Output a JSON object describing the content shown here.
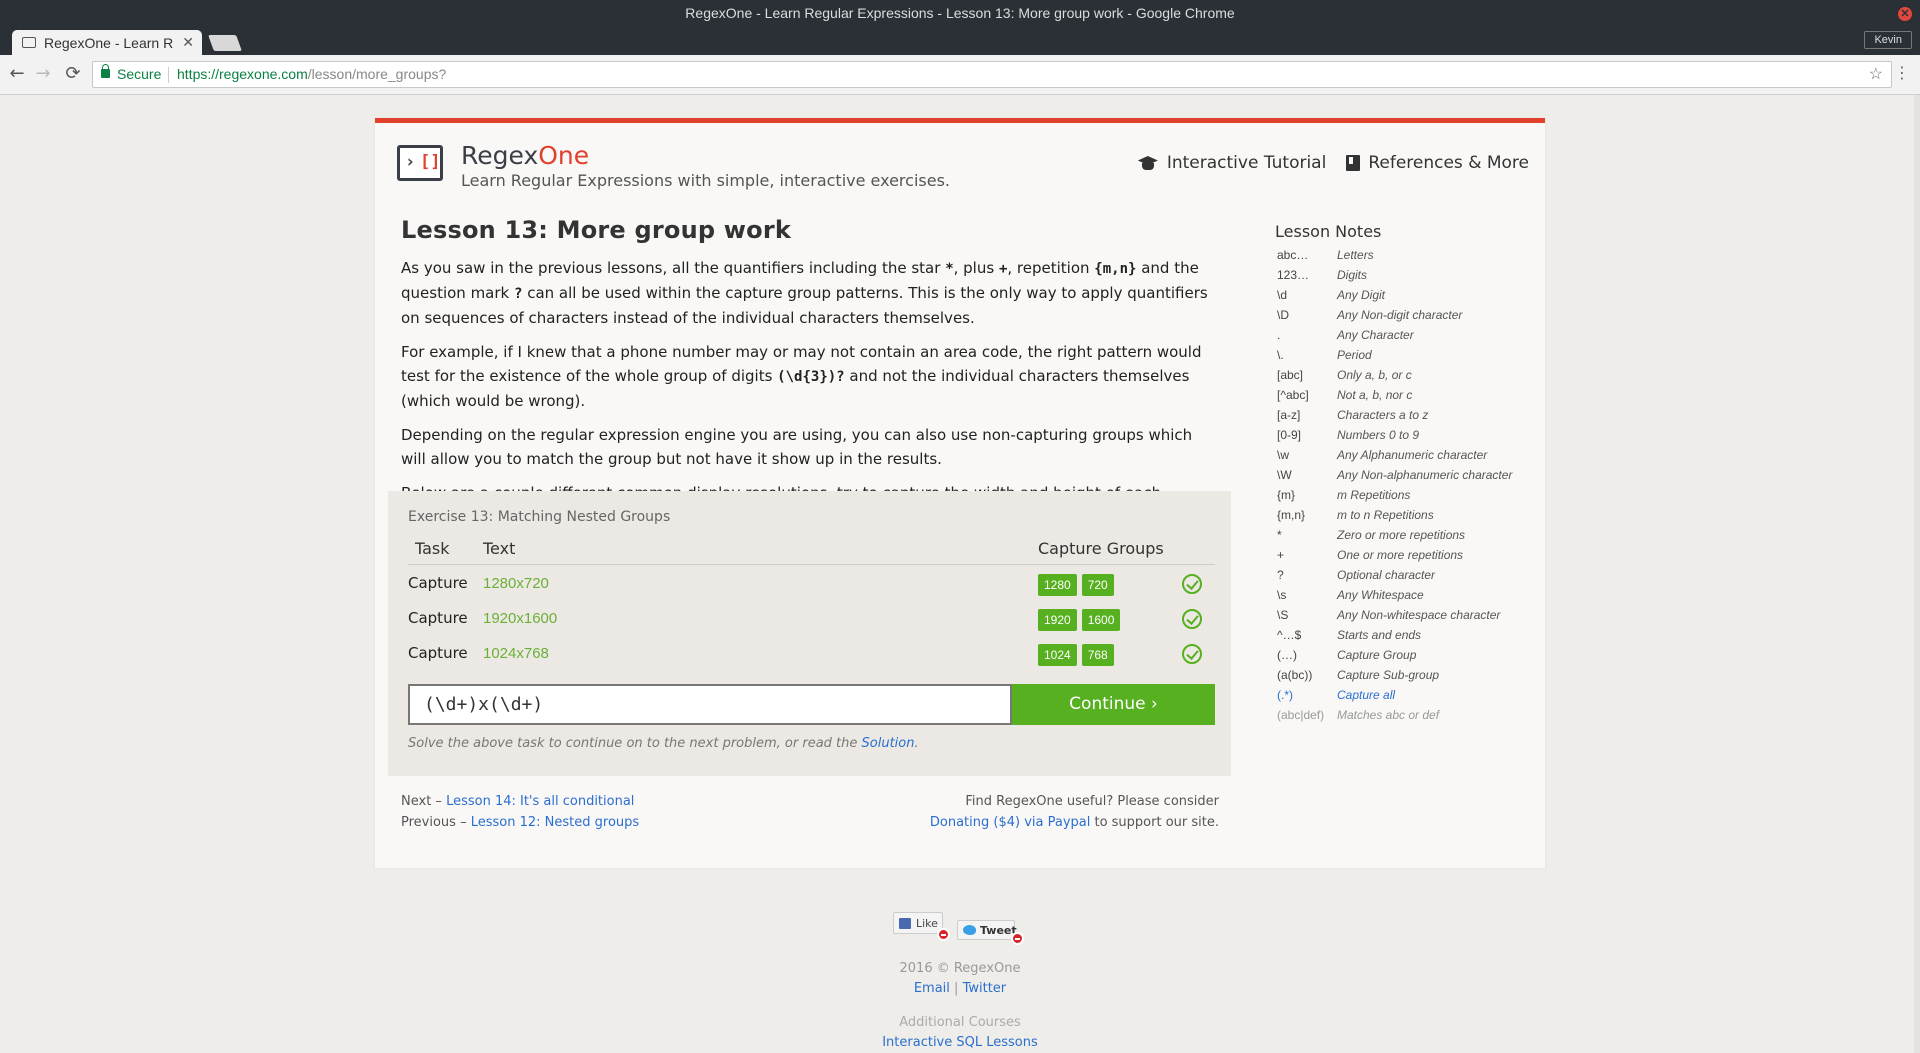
{
  "window": {
    "title": "RegexOne - Learn Regular Expressions - Lesson 13: More group work - Google Chrome",
    "close_glyph": "✕",
    "profile": "Kevin"
  },
  "tab": {
    "label": "RegexOne - Learn R",
    "close_glyph": "✕"
  },
  "toolbar": {
    "back_glyph": "←",
    "forward_glyph": "→",
    "reload_glyph": "⟳",
    "secure_label": "Secure",
    "url_host": "https://regexone.com",
    "url_path": "/lesson/more_groups?",
    "star_glyph": "☆",
    "menu_glyph": "⋮"
  },
  "site": {
    "brand_left": "Regex",
    "brand_right": "One",
    "tagline": "Learn Regular Expressions with simple, interactive exercises.",
    "nav": [
      {
        "label": "Interactive Tutorial",
        "icon": "graduation-cap-icon"
      },
      {
        "label": "References & More",
        "icon": "book-icon"
      }
    ]
  },
  "lesson": {
    "title": "Lesson 13: More group work",
    "p1_a": "As you saw in the previous lessons, all the quantifiers including the star ",
    "p1_star": "*",
    "p1_b": ", plus ",
    "p1_plus": "+",
    "p1_c": ", repetition ",
    "p1_rep": "{m,n}",
    "p1_d": " and the question mark ",
    "p1_q": "?",
    "p1_e": " can all be used within the capture group patterns. This is the only way to apply quantifiers on sequences of characters instead of the individual characters themselves.",
    "p2_a": "For example, if I knew that a phone number may or may not contain an area code, the right pattern would test for the existence of the whole group of digits ",
    "p2_code": "(\\d{3})?",
    "p2_b": " and not the individual characters themselves (which would be wrong).",
    "p3": "Depending on the regular expression engine you are using, you can also use non-capturing groups which will allow you to match the group but not have it show up in the results.",
    "p4": "Below are a couple different common display resolutions, try to capture the width and height of each display."
  },
  "exercise": {
    "title": "Exercise 13: Matching Nested Groups",
    "col_task": "Task",
    "col_text": "Text",
    "col_groups": "Capture Groups",
    "rows": [
      {
        "task": "Capture",
        "text": "1280x720",
        "groups": [
          "1280",
          "720"
        ],
        "status": "passed"
      },
      {
        "task": "Capture",
        "text": "1920x1600",
        "groups": [
          "1920",
          "1600"
        ],
        "status": "passed"
      },
      {
        "task": "Capture",
        "text": "1024x768",
        "groups": [
          "1024",
          "768"
        ],
        "status": "passed"
      }
    ],
    "input_value": "(\\d+)x(\\d+)",
    "continue_label": "Continue ›",
    "solve_note": "Solve the above task to continue on to the next problem, or read the ",
    "solution_link": "Solution",
    "solve_note_end": "."
  },
  "footer_nav": {
    "next_prefix": "Next – ",
    "next_link": "Lesson 14: It's all conditional",
    "prev_prefix": "Previous – ",
    "prev_link": "Lesson 12: Nested groups",
    "donate_line1": "Find RegexOne useful? Please consider",
    "donate_link": "Donating ($4) via Paypal",
    "donate_line2": " to support our site."
  },
  "notes": {
    "title": "Lesson Notes",
    "items": [
      {
        "k": "abc…",
        "v": "Letters"
      },
      {
        "k": "123…",
        "v": "Digits"
      },
      {
        "k": "\\d",
        "v": "Any Digit"
      },
      {
        "k": "\\D",
        "v": "Any Non-digit character"
      },
      {
        "k": ".",
        "v": "Any Character"
      },
      {
        "k": "\\.",
        "v": "Period"
      },
      {
        "k": "[abc]",
        "v": "Only a, b, or c"
      },
      {
        "k": "[^abc]",
        "v": "Not a, b, nor c"
      },
      {
        "k": "[a-z]",
        "v": "Characters a to z"
      },
      {
        "k": "[0-9]",
        "v": "Numbers 0 to 9"
      },
      {
        "k": "\\w",
        "v": "Any Alphanumeric character"
      },
      {
        "k": "\\W",
        "v": "Any Non-alphanumeric character"
      },
      {
        "k": "{m}",
        "v": "m Repetitions"
      },
      {
        "k": "{m,n}",
        "v": "m to n Repetitions"
      },
      {
        "k": "*",
        "v": "Zero or more repetitions"
      },
      {
        "k": "+",
        "v": "One or more repetitions"
      },
      {
        "k": "?",
        "v": "Optional character"
      },
      {
        "k": "\\s",
        "v": "Any Whitespace"
      },
      {
        "k": "\\S",
        "v": "Any Non-whitespace character"
      },
      {
        "k": "^…$",
        "v": "Starts and ends"
      },
      {
        "k": "(…)",
        "v": "Capture Group"
      },
      {
        "k": "(a(bc))",
        "v": "Capture Sub-group"
      },
      {
        "k": "(.*)",
        "v": "Capture all"
      },
      {
        "k": "(abc|def)",
        "v": "Matches abc or def"
      }
    ]
  },
  "social": {
    "like_label": "Like",
    "tweet_label": "Tweet"
  },
  "page_footer": {
    "copyright": "2016 © RegexOne",
    "email": "Email",
    "separator": "|",
    "twitter": "Twitter",
    "additional": "Additional Courses",
    "sql": "Interactive SQL Lessons"
  },
  "colors": {
    "accent_red": "#e0412d",
    "success_green": "#56b01f",
    "link_blue": "#2a6fcf"
  }
}
